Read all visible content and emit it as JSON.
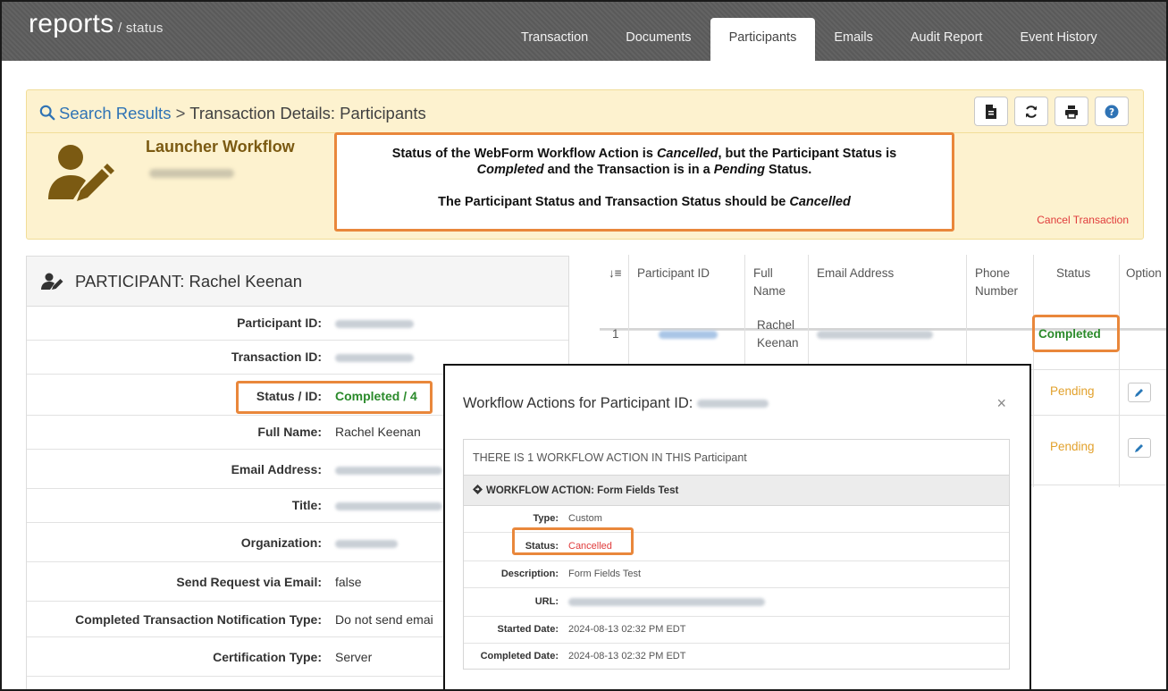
{
  "header": {
    "brand": "reports",
    "brand_sub": " / status",
    "tabs": [
      "Transaction",
      "Documents",
      "Participants",
      "Emails",
      "Audit Report",
      "Event History"
    ],
    "active_tab": "Participants"
  },
  "breadcrumb": {
    "link": "Search Results",
    "separator": ">",
    "current": "Transaction Details: Participants"
  },
  "toolbar": {
    "buttons": [
      "document-icon",
      "refresh-icon",
      "print-icon",
      "help-icon"
    ]
  },
  "workflow": {
    "name": "Launcher Workflow",
    "cancel_link": "Cancel Transaction"
  },
  "callout": {
    "line1a": "Status of the WebForm Workflow Action is ",
    "line1b": "Cancelled",
    "line1c": ", but the Participant Status is",
    "line2a": "Completed",
    "line2b": " and the Transaction is in a ",
    "line2c": "Pending",
    "line2d": " Status.",
    "line3a": "The Participant Status and Transaction Status should be ",
    "line3b": "Cancelled"
  },
  "participant": {
    "title": "PARTICIPANT: Rachel Keenan",
    "labels": {
      "participant_id": "Participant ID:",
      "transaction_id": "Transaction ID:",
      "status_id": "Status / ID:",
      "full_name": "Full Name:",
      "email": "Email Address:",
      "title": "Title:",
      "organization": "Organization:",
      "send_request": "Send Request via Email:",
      "completed_notification": "Completed Transaction Notification Type:",
      "certification": "Certification Type:"
    },
    "values": {
      "status_id": "Completed / 4",
      "full_name": "Rachel Keenan",
      "send_request": "false",
      "completed_notification": "Do not send emai",
      "certification": "Server"
    }
  },
  "table": {
    "headers": {
      "sort": "↓≡",
      "participant_id": "Participant ID",
      "full_name_1": "Full",
      "full_name_2": "Name",
      "email": "Email Address",
      "phone_1": "Phone",
      "phone_2": "Number",
      "status": "Status",
      "options": "Option"
    },
    "rows": [
      {
        "index": "1",
        "name_1": "Rachel",
        "name_2": "Keenan",
        "status": "Completed"
      },
      {
        "status": "Pending"
      },
      {
        "status": "Pending"
      }
    ]
  },
  "modal": {
    "title": "Workflow Actions for Participant ID: ",
    "close": "×",
    "count_text": "THERE IS 1 WORKFLOW ACTION IN THIS Participant",
    "action_head": "WORKFLOW ACTION: Form Fields Test",
    "labels": {
      "type": "Type:",
      "status": "Status:",
      "description": "Description:",
      "url": "URL:",
      "started": "Started Date:",
      "completed": "Completed Date:"
    },
    "values": {
      "type": "Custom",
      "status": "Cancelled",
      "description": "Form Fields Test",
      "started": "2024-08-13 02:32 PM EDT",
      "completed": "2024-08-13 02:32 PM EDT"
    }
  },
  "colors": {
    "highlight": "#e9873b",
    "completed": "#2b8a2b",
    "pending": "#e2a12c",
    "cancelled": "#e03b3b",
    "link": "#2f73b5"
  }
}
